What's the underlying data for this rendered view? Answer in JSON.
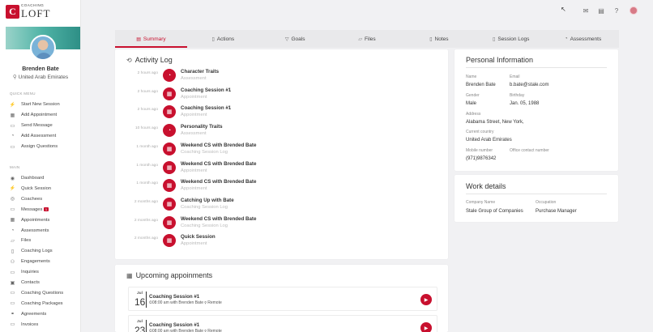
{
  "brand": {
    "small": "COACHING",
    "big": "LOFT",
    "mark": "C"
  },
  "profile": {
    "name": "Brenden Bate",
    "location": "United Arab Emirates"
  },
  "sidebar": {
    "quick_menu_label": "QUICK MENU",
    "quick_items": [
      {
        "label": "Start New Session",
        "icon": "⚡"
      },
      {
        "label": "Add Appointment",
        "icon": "▦"
      },
      {
        "label": "Send Message",
        "icon": "▭"
      },
      {
        "label": "Add Assessment",
        "icon": "◔"
      },
      {
        "label": "Assign Questions",
        "icon": "▭"
      }
    ],
    "main_label": "MAIN",
    "main_items": [
      {
        "label": "Dashboard",
        "icon": "◉"
      },
      {
        "label": "Quick Session",
        "icon": "⚡"
      },
      {
        "label": "Coachees",
        "icon": "◎"
      },
      {
        "label": "Messages",
        "icon": "▭",
        "badge": "1"
      },
      {
        "label": "Appointments",
        "icon": "▦"
      },
      {
        "label": "Assessments",
        "icon": "◔"
      },
      {
        "label": "Files",
        "icon": "▱"
      },
      {
        "label": "Coaching Logs",
        "icon": "▯"
      },
      {
        "label": "Engagements",
        "icon": "⚇"
      },
      {
        "label": "Inquiries",
        "icon": "▭"
      },
      {
        "label": "Contacts",
        "icon": "▣"
      },
      {
        "label": "Coaching Questions",
        "icon": "▭"
      },
      {
        "label": "Coaching Packages",
        "icon": "▭"
      },
      {
        "label": "Agreements",
        "icon": "⚭"
      },
      {
        "label": "Invoices",
        "icon": "▭"
      }
    ]
  },
  "tabs": [
    {
      "label": "Summary",
      "icon": "▤",
      "active": true
    },
    {
      "label": "Actions",
      "icon": "▯"
    },
    {
      "label": "Goals",
      "icon": "▽"
    },
    {
      "label": "Files",
      "icon": "▱"
    },
    {
      "label": "Notes",
      "icon": "▯"
    },
    {
      "label": "Session Logs",
      "icon": "▯"
    },
    {
      "label": "Assessments",
      "icon": "◔"
    }
  ],
  "activity": {
    "title": "Activity Log",
    "items": [
      {
        "time": "2 hours ago",
        "title": "Character Traits",
        "sub": "Assessment",
        "icon": "◔"
      },
      {
        "time": "2 hours ago",
        "title": "Coaching Session #1",
        "sub": "Appointment",
        "icon": "▦"
      },
      {
        "time": "2 hours ago",
        "title": "Coaching Session #1",
        "sub": "Appointment",
        "icon": "▦"
      },
      {
        "time": "10 hours ago",
        "title": "Personality Traits",
        "sub": "Assessment",
        "icon": "◔"
      },
      {
        "time": "1 month ago",
        "title": "Weekend CS with Brended Bate",
        "sub": "Coaching Session Log",
        "icon": "▦"
      },
      {
        "time": "1 month ago",
        "title": "Weekend CS with Brended Bate",
        "sub": "Appointment",
        "icon": "▦"
      },
      {
        "time": "1 month ago",
        "title": "Weekend CS with Brended Bate",
        "sub": "Appointment",
        "icon": "▦"
      },
      {
        "time": "2 months ago",
        "title": "Catching Up with Bate",
        "sub": "Coaching Session Log",
        "icon": "▦"
      },
      {
        "time": "2 months ago",
        "title": "Weekend CS with Brended Bate",
        "sub": "Coaching Session Log",
        "icon": "▦"
      },
      {
        "time": "2 months ago",
        "title": "Quick Session",
        "sub": "Appointment",
        "icon": "▦"
      }
    ]
  },
  "personal": {
    "title": "Personal Information",
    "name_label": "Name",
    "name": "Brenden Bate",
    "email_label": "Email",
    "email": "b.bate@stale.com",
    "gender_label": "Gender",
    "gender": "Male",
    "birthday_label": "Birthday",
    "birthday": "Jan. 05, 1988",
    "address_label": "Address",
    "address": "Alabama Street, New York,",
    "country_label": "Current country",
    "country": "United Arab Emirates",
    "mobile_label": "Mobile number",
    "mobile": "(971)9876342",
    "office_label": "Office contact number",
    "office": ""
  },
  "work": {
    "title": "Work details",
    "company_label": "Company Name",
    "company": "Stale Group of Companies",
    "occupation_label": "Occupation",
    "occupation": "Purchase Manager"
  },
  "upcoming": {
    "title": "Upcoming appoinments",
    "items": [
      {
        "month": "Jul",
        "day": "16",
        "title": "Coaching Session #1",
        "sub": "⏲08:00 am with Brenden Bate  ⚲ Remote"
      },
      {
        "month": "Jul",
        "day": "23",
        "title": "Coaching Session #1",
        "sub": "⏲08:00 am with Brenden Bate  ⚲ Remote"
      }
    ]
  },
  "colors": {
    "accent": "#c8102e",
    "banner": "#4fb3a6"
  }
}
